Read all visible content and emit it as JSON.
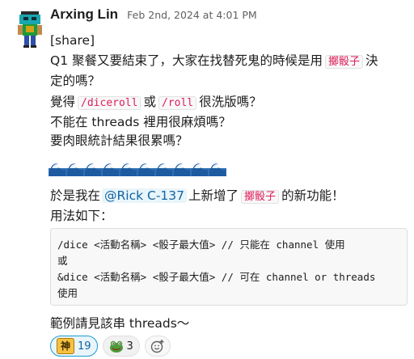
{
  "message": {
    "author": "Arxing Lin",
    "timestamp": "Feb 2nd, 2024 at 4:01 PM",
    "line1": "[share]",
    "line2_pre": "Q1 聚餐又要結束了，大家在找替死鬼的時候是用",
    "line2_code": "擲骰子",
    "line2_post": "決",
    "line3": "定的嗎？",
    "line4_pre": "覺得",
    "line4_code1": "/diceroll",
    "line4_mid": "或",
    "line4_code2": "/roll",
    "line4_post": "很洗版嗎？",
    "line5": "不能在 threads 裡用很麻煩嗎？",
    "line6": "要肉眼統計結果很累嗎？",
    "line8_pre": "於是我在",
    "line8_mention": "@Rick C-137",
    "line8_mid": "上新增了",
    "line8_code": "擲骰子",
    "line8_post": "的新功能！",
    "line9": "用法如下：",
    "code_lines": [
      "/dice <活動名稱> <骰子最大值> // 只能在 channel 使用",
      "或",
      "&dice <活動名稱> <骰子最大值> // 可在 channel or threads",
      "使用"
    ],
    "closing": "範例請見該串 threads～"
  },
  "reactions": [
    {
      "label": "神",
      "count": "19",
      "active": true
    },
    {
      "icon": "frog-emoji-icon",
      "count": "3",
      "active": false
    }
  ],
  "colors": {
    "code_text": "#e01e5a",
    "mention": "#1264a3",
    "active_border": "#1d9bd1"
  }
}
